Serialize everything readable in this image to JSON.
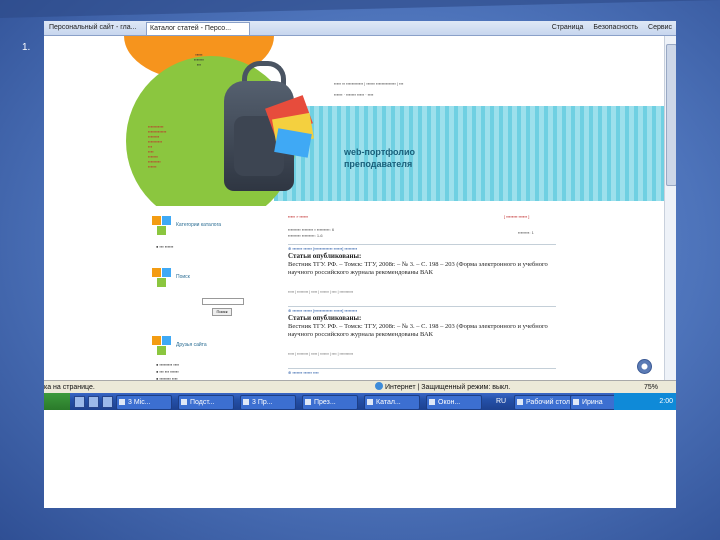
{
  "slide": {
    "number": "1."
  },
  "browser": {
    "tabs": [
      "Персональный сайт - гла...",
      "Каталог статей - Персо..."
    ],
    "toolbar": [
      "Страница",
      "Безопасность",
      "Сервис"
    ]
  },
  "page": {
    "header_title_line1": "web-портфолио",
    "header_title_line2": "преподавателя",
    "side_blocks": [
      {
        "title": "Категории каталога"
      },
      {
        "title": "Поиск"
      },
      {
        "title": "Друзья сайта"
      }
    ],
    "search_button": "Поиск",
    "entries": [
      {
        "title": "Статьи опубликованы:",
        "body": "Вестник ТГУ. РФ. – Томск: ТГУ, 2008г. – № 3. – С. 198 – 203 (Форма электронного и учебного научного российского журнала рекомендованы ВАК"
      },
      {
        "title": "Статьи опубликованы:",
        "body": "Вестник ТГУ. РФ. – Томск: ТГУ, 2008г. – № 3. – С. 198 – 203 (Форма электронного и учебного научного российского журнала рекомендованы ВАК"
      }
    ]
  },
  "statusbar": {
    "left": "ка на странице.",
    "zone": "Интернет | Защищенный режим: выкл.",
    "zoom": "75%"
  },
  "taskbar": {
    "items": [
      "3 Mic...",
      "Подст...",
      "3 Пр...",
      "През...",
      "Катал...",
      "Окон...",
      "Рабочий стол",
      "Ирина"
    ],
    "lang": "RU",
    "clock": "2:00"
  }
}
